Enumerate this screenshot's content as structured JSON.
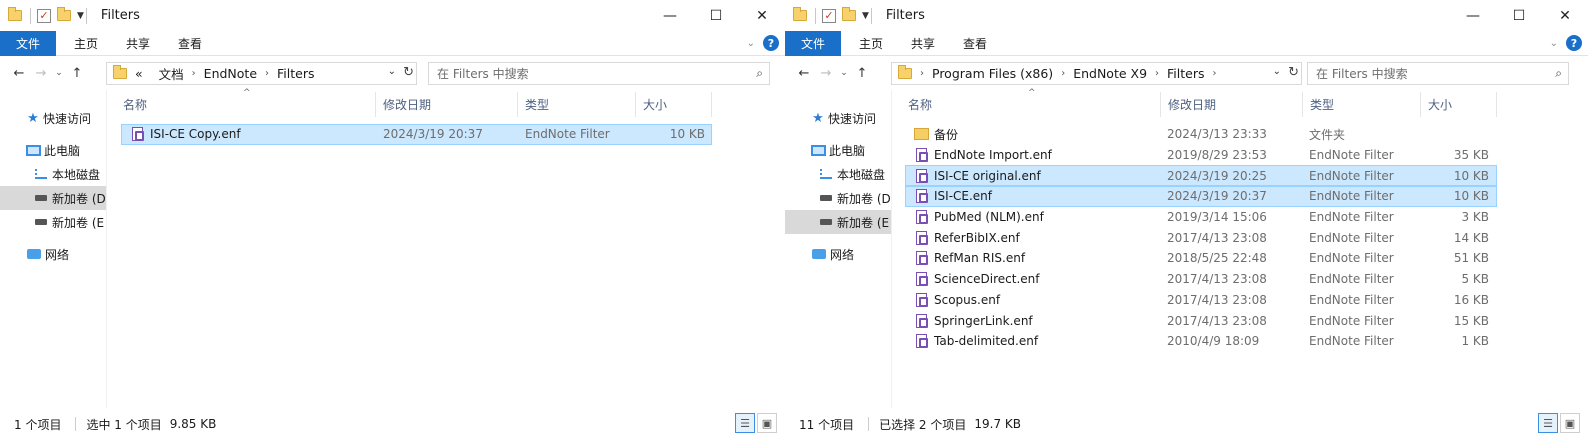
{
  "windows": [
    {
      "title": "Filters",
      "ribbon_tabs": [
        "文件",
        "主页",
        "共享",
        "查看"
      ],
      "breadcrumb": [
        "«",
        "文档",
        "EndNote",
        "Filters"
      ],
      "search_placeholder": "在 Filters 中搜索",
      "sidebar": [
        {
          "label": "快速访问",
          "icon": "quick-access-star-icon"
        },
        {
          "label": "此电脑",
          "icon": "this-pc-icon"
        },
        {
          "label": "本地磁盘",
          "icon": "local-disk-icon"
        },
        {
          "label": "新加卷 (D",
          "icon": "drive-icon",
          "selected": true
        },
        {
          "label": "新加卷 (E",
          "icon": "drive-icon"
        },
        {
          "label": "网络",
          "icon": "network-icon"
        }
      ],
      "columns": [
        "名称",
        "修改日期",
        "类型",
        "大小"
      ],
      "files": [
        {
          "name": "ISI-CE Copy.enf",
          "date": "2024/3/19 20:37",
          "type": "EndNote Filter",
          "size": "10 KB",
          "selected": true,
          "icon": "enf-file-icon"
        }
      ],
      "status": {
        "count": "1 个项目",
        "selection": "选中 1 个项目",
        "size": "9.85 KB"
      }
    },
    {
      "title": "Filters",
      "ribbon_tabs": [
        "文件",
        "主页",
        "共享",
        "查看"
      ],
      "breadcrumb": [
        "Program Files (x86)",
        "EndNote X9",
        "Filters"
      ],
      "search_placeholder": "在 Filters 中搜索",
      "sidebar": [
        {
          "label": "快速访问",
          "icon": "quick-access-star-icon"
        },
        {
          "label": "此电脑",
          "icon": "this-pc-icon"
        },
        {
          "label": "本地磁盘",
          "icon": "local-disk-icon"
        },
        {
          "label": "新加卷 (D",
          "icon": "drive-icon"
        },
        {
          "label": "新加卷 (E",
          "icon": "drive-icon",
          "selected": true
        },
        {
          "label": "网络",
          "icon": "network-icon"
        }
      ],
      "columns": [
        "名称",
        "修改日期",
        "类型",
        "大小"
      ],
      "files": [
        {
          "name": "备份",
          "date": "2024/3/13 23:33",
          "type": "文件夹",
          "size": "",
          "selected": false,
          "icon": "folder-icon"
        },
        {
          "name": "EndNote Import.enf",
          "date": "2019/8/29 23:53",
          "type": "EndNote Filter",
          "size": "35 KB",
          "selected": false,
          "icon": "enf-file-icon"
        },
        {
          "name": "ISI-CE original.enf",
          "date": "2024/3/19 20:25",
          "type": "EndNote Filter",
          "size": "10 KB",
          "selected": true,
          "icon": "enf-file-icon"
        },
        {
          "name": "ISI-CE.enf",
          "date": "2024/3/19 20:37",
          "type": "EndNote Filter",
          "size": "10 KB",
          "selected": true,
          "icon": "enf-file-icon"
        },
        {
          "name": "PubMed (NLM).enf",
          "date": "2019/3/14 15:06",
          "type": "EndNote Filter",
          "size": "3 KB",
          "selected": false,
          "icon": "enf-file-icon"
        },
        {
          "name": "ReferBibIX.enf",
          "date": "2017/4/13 23:08",
          "type": "EndNote Filter",
          "size": "14 KB",
          "selected": false,
          "icon": "enf-file-icon"
        },
        {
          "name": "RefMan RIS.enf",
          "date": "2018/5/25 22:48",
          "type": "EndNote Filter",
          "size": "51 KB",
          "selected": false,
          "icon": "enf-file-icon"
        },
        {
          "name": "ScienceDirect.enf",
          "date": "2017/4/13 23:08",
          "type": "EndNote Filter",
          "size": "5 KB",
          "selected": false,
          "icon": "enf-file-icon"
        },
        {
          "name": "Scopus.enf",
          "date": "2017/4/13 23:08",
          "type": "EndNote Filter",
          "size": "16 KB",
          "selected": false,
          "icon": "enf-file-icon"
        },
        {
          "name": "SpringerLink.enf",
          "date": "2017/4/13 23:08",
          "type": "EndNote Filter",
          "size": "15 KB",
          "selected": false,
          "icon": "enf-file-icon"
        },
        {
          "name": "Tab-delimited.enf",
          "date": "2010/4/9 18:09",
          "type": "EndNote Filter",
          "size": "1 KB",
          "selected": false,
          "icon": "enf-file-icon"
        }
      ],
      "status": {
        "count": "11 个项目",
        "selection": "已选择 2 个项目",
        "size": "19.7 KB"
      }
    }
  ]
}
